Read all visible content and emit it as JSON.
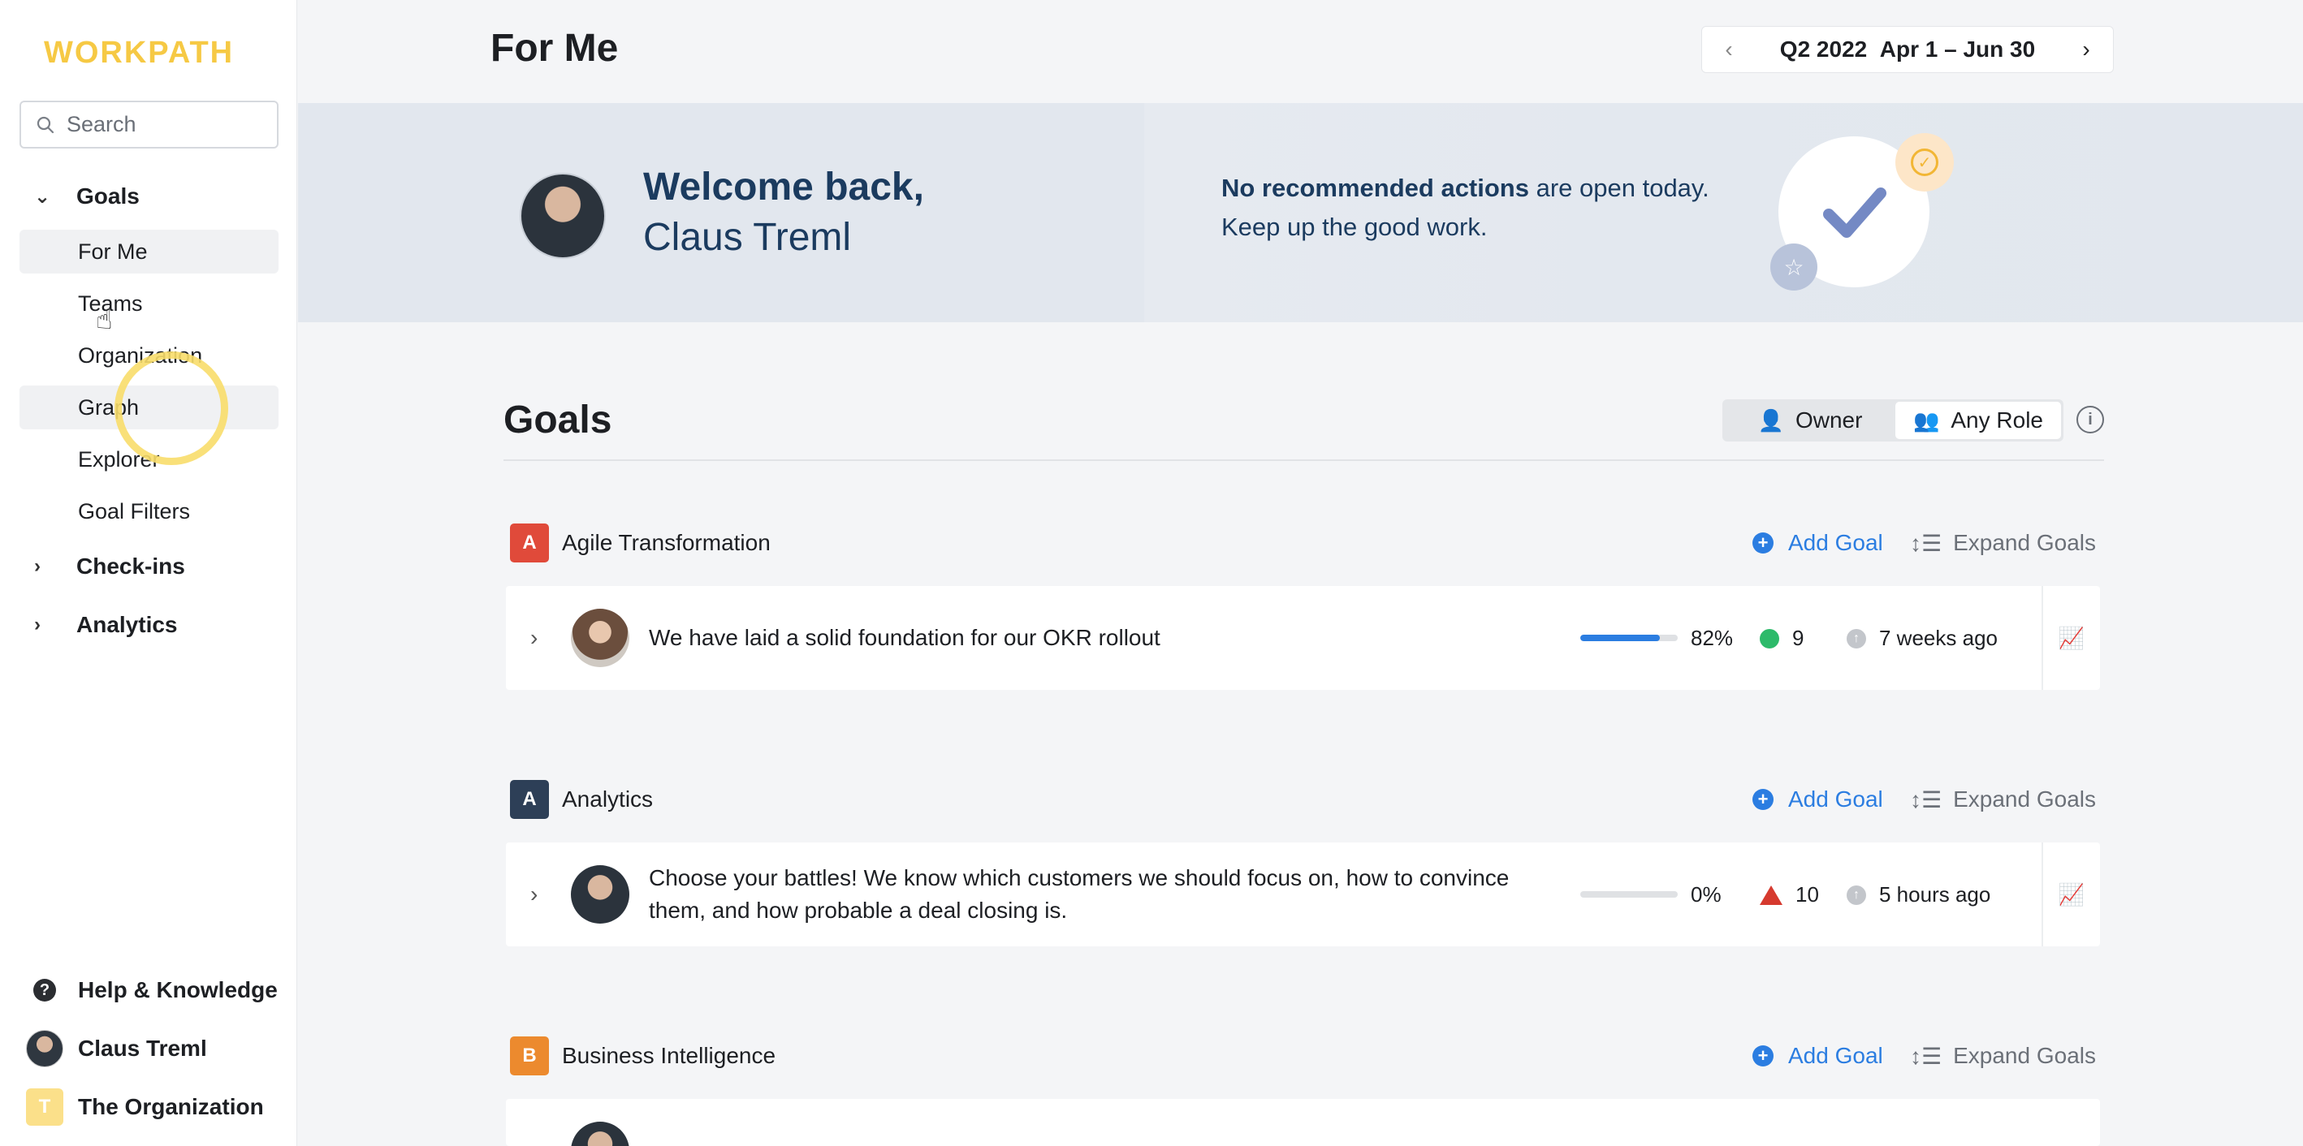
{
  "sidebar": {
    "logo": "WORKPATH",
    "search_placeholder": "Search",
    "goals_label": "Goals",
    "items": [
      {
        "label": "For Me"
      },
      {
        "label": "Teams"
      },
      {
        "label": "Organization"
      },
      {
        "label": "Graph"
      },
      {
        "label": "Explorer"
      },
      {
        "label": "Goal Filters"
      }
    ],
    "checkins_label": "Check-ins",
    "analytics_label": "Analytics",
    "help_label": "Help & Knowledge",
    "user_name": "Claus Treml",
    "org_initial": "T",
    "org_name": "The Organization"
  },
  "header": {
    "title": "For Me",
    "period_quarter": "Q2 2022",
    "period_range": "Apr 1 – Jun 30"
  },
  "banner": {
    "welcome_line1": "Welcome back,",
    "welcome_line2": "Claus Treml",
    "reco_bold": "No recommended actions",
    "reco_rest": " are open today.",
    "reco_line2": "Keep up the good work."
  },
  "goals": {
    "title": "Goals",
    "owner_label": "Owner",
    "any_role_label": "Any Role",
    "add_goal_label": "Add Goal",
    "expand_goals_label": "Expand Goals",
    "groups": [
      {
        "letter": "A",
        "color": "#e04a3a",
        "name": "Agile Transformation",
        "goal": {
          "text": "We have laid a solid foundation for our OKR rollout",
          "progress": 82,
          "progress_label": "82%",
          "status_count": "9",
          "updated": "7 weeks ago"
        }
      },
      {
        "letter": "A",
        "color": "#2d3f57",
        "name": "Analytics",
        "goal": {
          "text": "Choose your battles! We know which customers we should focus on, how to convince them, and how probable a deal closing is.",
          "progress": 0,
          "progress_label": "0%",
          "status_count": "10",
          "updated": "5 hours ago"
        }
      },
      {
        "letter": "B",
        "color": "#ec8a2e",
        "name": "Business Intelligence"
      }
    ]
  }
}
